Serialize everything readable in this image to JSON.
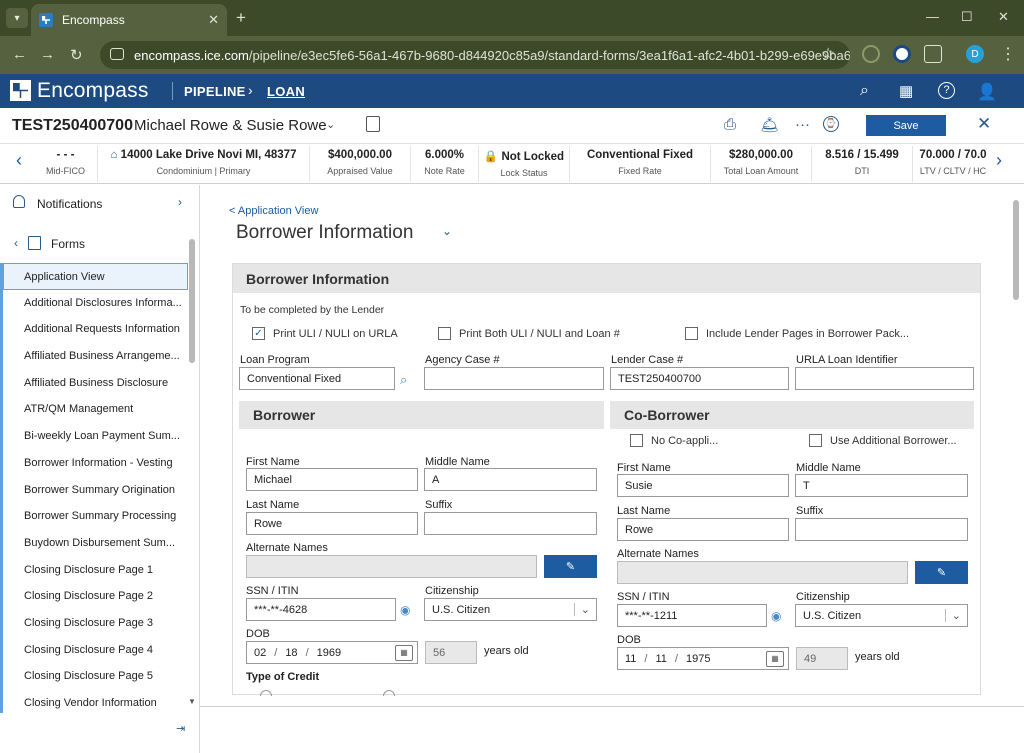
{
  "browser": {
    "tab_title": "Encompass",
    "url_host": "encompass.ice.com",
    "url_path": "/pipeline/e3ec5fe6-56a1-467b-9680-d844920c85a9/standard-forms/3ea1f6a1-afc2-4b01-b299-e69e9ba626e",
    "profile_initial": "D"
  },
  "app": {
    "logo_text": "Encompass",
    "nav_pipeline": "PIPELINE",
    "nav_loan": "LOAN"
  },
  "loan": {
    "number": "TEST250400700",
    "borrower_names": "Michael Rowe & Susie Rowe",
    "save_label": "Save"
  },
  "summary": [
    {
      "value": "- - -",
      "label": "Mid-FICO"
    },
    {
      "value": "14000 Lake Drive Novi MI, 48377",
      "label": "Condominium | Primary"
    },
    {
      "value": "$400,000.00",
      "label": "Appraised Value"
    },
    {
      "value": "6.000%",
      "label": "Note Rate"
    },
    {
      "value": "Not Locked",
      "label": "Lock Status"
    },
    {
      "value": "Conventional Fixed",
      "label": "Fixed Rate"
    },
    {
      "value": "$280,000.00",
      "label": "Total Loan Amount"
    },
    {
      "value": "8.516 / 15.499",
      "label": "DTI"
    },
    {
      "value": "70.000 / 70.0",
      "label": "LTV / CLTV / HC"
    }
  ],
  "sidebar": {
    "notifications": "Notifications",
    "forms": "Forms",
    "items": [
      "Application View",
      "Additional Disclosures Informa...",
      "Additional Requests Information",
      "Affiliated Business Arrangeme...",
      "Affiliated Business Disclosure",
      "ATR/QM Management",
      "Bi-weekly Loan Payment Sum...",
      "Borrower Information - Vesting",
      "Borrower Summary Origination",
      "Borrower Summary Processing",
      "Buydown Disbursement Sum...",
      "Closing Disclosure Page 1",
      "Closing Disclosure Page 2",
      "Closing Disclosure Page 3",
      "Closing Disclosure Page 4",
      "Closing Disclosure Page 5",
      "Closing Vendor Information"
    ]
  },
  "main": {
    "back_link": "< Application View",
    "title": "Borrower Information",
    "panel_title": "Borrower Information",
    "lender_note": "To be completed by the Lender",
    "check_uli": "Print ULI / NULI on URLA",
    "check_both": "Print Both ULI / NULI and Loan #",
    "check_lender_pages": "Include Lender Pages in Borrower Pack...",
    "loan_program_label": "Loan Program",
    "loan_program_value": "Conventional Fixed",
    "agency_case_label": "Agency Case #",
    "agency_case_value": "",
    "lender_case_label": "Lender Case #",
    "lender_case_value": "TEST250400700",
    "urla_id_label": "URLA Loan Identifier",
    "urla_id_value": ""
  },
  "borrower": {
    "section": "Borrower",
    "first_name_label": "First Name",
    "first_name": "Michael",
    "middle_name_label": "Middle Name",
    "middle_name": "A",
    "last_name_label": "Last Name",
    "last_name": "Rowe",
    "suffix_label": "Suffix",
    "suffix": "",
    "alt_names_label": "Alternate Names",
    "ssn_label": "SSN / ITIN",
    "ssn": "***-**-4628",
    "citizenship_label": "Citizenship",
    "citizenship": "U.S. Citizen",
    "dob_label": "DOB",
    "dob_mm": "02",
    "dob_dd": "18",
    "dob_yyyy": "1969",
    "age": "56",
    "years_old": "years old",
    "credit_type_label": "Type of Credit"
  },
  "coborrower": {
    "section": "Co-Borrower",
    "no_coapp": "No Co-appli...",
    "use_additional": "Use Additional Borrower...",
    "first_name_label": "First Name",
    "first_name": "Susie",
    "middle_name_label": "Middle Name",
    "middle_name": "T",
    "last_name_label": "Last Name",
    "last_name": "Rowe",
    "suffix_label": "Suffix",
    "suffix": "",
    "alt_names_label": "Alternate Names",
    "ssn_label": "SSN / ITIN",
    "ssn": "***-**-1211",
    "citizenship_label": "Citizenship",
    "citizenship": "U.S. Citizen",
    "dob_label": "DOB",
    "dob_mm": "11",
    "dob_dd": "11",
    "dob_yyyy": "1975",
    "age": "49",
    "years_old": "years old"
  },
  "colors": {
    "app_header": "#1d4a80",
    "primary_button": "#1d5ca1",
    "browser_frame": "#3d4a2a"
  }
}
